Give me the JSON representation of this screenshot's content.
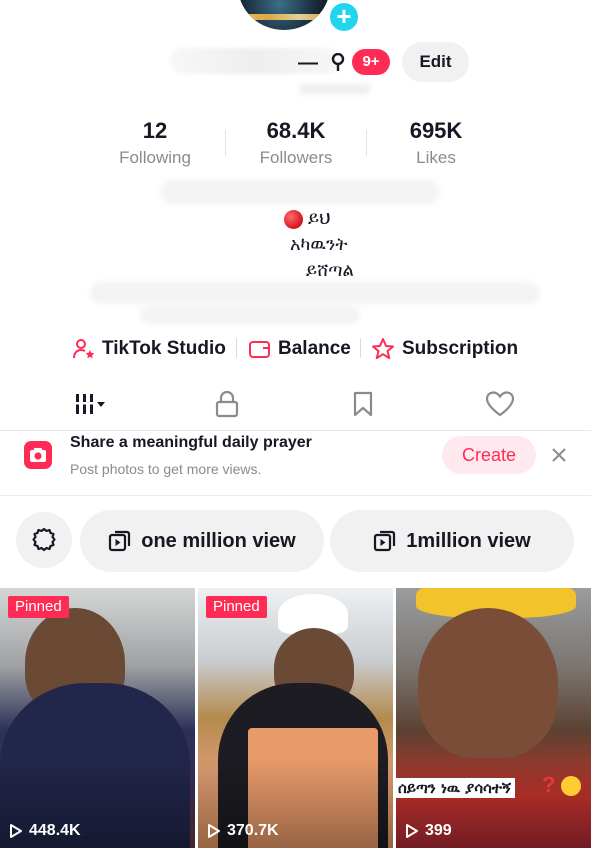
{
  "profile": {
    "username_visible": "—",
    "notifications_badge": "9+",
    "edit_label": "Edit",
    "stats": [
      {
        "value": "12",
        "label": "Following"
      },
      {
        "value": "68.4K",
        "label": "Followers"
      },
      {
        "value": "695K",
        "label": "Likes"
      }
    ],
    "bio_lines": [
      "ይህ",
      "አካዉንት",
      "ይሸጣል"
    ]
  },
  "tools": [
    {
      "label": "TikTok Studio",
      "icon": "person-star-icon"
    },
    {
      "label": "Balance",
      "icon": "wallet-icon"
    },
    {
      "label": "Subscription",
      "icon": "star-outline-icon"
    }
  ],
  "tabs": [
    {
      "name": "videos-grid",
      "icon": "grid-bars-icon"
    },
    {
      "name": "private",
      "icon": "lock-icon"
    },
    {
      "name": "saved",
      "icon": "bookmark-icon"
    },
    {
      "name": "liked",
      "icon": "heart-icon"
    }
  ],
  "banner": {
    "title": "Share a meaningful daily prayer",
    "subtitle": "Post photos to get more views.",
    "create_label": "Create"
  },
  "playlists": [
    {
      "label": "one million view"
    },
    {
      "label": "1million view"
    }
  ],
  "videos": [
    {
      "pinned": "Pinned",
      "views": "448.4K"
    },
    {
      "pinned": "Pinned",
      "views": "370.7K"
    },
    {
      "pinned": "",
      "views": "399",
      "caption": "ሰይጣን ነዉ ያሳሳተኝ",
      "caption_mark": "?"
    }
  ],
  "colors": {
    "accent": "#fe2c55",
    "avatar_add": "#20d5ec",
    "text": "#161823",
    "muted": "#8a8b91",
    "chip_bg": "#f1f1f2"
  }
}
